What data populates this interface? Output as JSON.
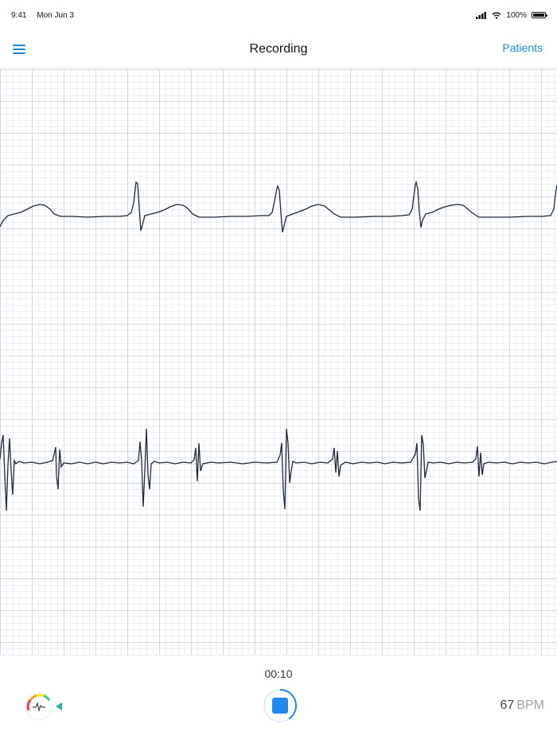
{
  "status_bar": {
    "time": "9:41",
    "date": "Mon Jun 3",
    "battery": "100%",
    "icons": [
      "cellular-signal-icon",
      "wifi-icon",
      "battery-icon"
    ]
  },
  "nav": {
    "title": "Recording",
    "right_action": "Patients",
    "left_icon": "hamburger-menu-icon"
  },
  "ecg": {
    "leads": 2,
    "grid": true,
    "trace_color": "#1f2a3a",
    "beat_count_visible": 4
  },
  "controls": {
    "elapsed": "00:10",
    "record_state": "recording",
    "heart_rate_value": "67",
    "heart_rate_unit": "BPM",
    "accent_color": "#1e88f0",
    "gauge_colors": [
      "#e8423c",
      "#f5a623",
      "#f8e71c",
      "#3ecf8e",
      "#1fb5a0"
    ]
  }
}
